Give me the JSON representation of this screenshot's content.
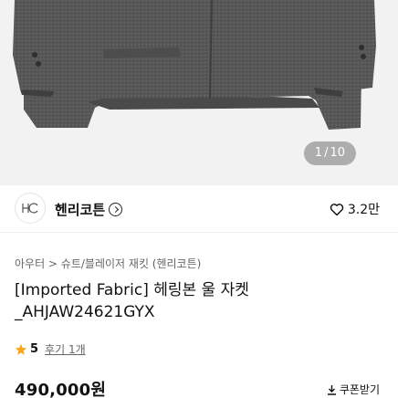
{
  "gallery": {
    "current": "1",
    "separator": "/",
    "total": "10",
    "background_color": "#f2f2f2",
    "jacket_color": "#555555"
  },
  "brand": {
    "name": "헨리코튼",
    "logo_text": "HC",
    "like_count": "3.2만"
  },
  "breadcrumb": "아우터 > 슈트/블레이저 재킷 (헨리코튼)",
  "product": {
    "title": "[Imported Fabric] 헤링본 울 자켓_AHJAW24621GYX",
    "rating": "5",
    "review_link": "후기 1개",
    "price": "490,000원",
    "coupon_label": "쿠폰받기"
  },
  "colors": {
    "star": "#f5a623",
    "accent_dark": "#111111"
  }
}
